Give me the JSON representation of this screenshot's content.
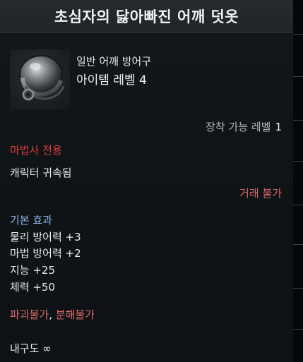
{
  "tooltip": {
    "title": "초심자의 닳아빠진 어깨 덧옷",
    "item_type": "일반 어깨 방어구",
    "item_level": "아이템 레벨 4",
    "equip_level_label": "장착 가능 레벨",
    "equip_level_value": "1",
    "class_restriction": "마법사 전용",
    "binding": "캐릭터 귀속됨",
    "trade": "거래 불가",
    "base_effects_label": "기본 효과",
    "stats": [
      "물리 방어력 +3",
      "마법 방어력 +2",
      "지능 +25",
      "체력 +50"
    ],
    "destroy": "파괴불가",
    "separator": ",",
    "dismantle": "분해불가",
    "durability": "내구도 ∞",
    "icon": "pauldron-armor-icon"
  },
  "colors": {
    "restriction_red": "#e23b3b",
    "effect_blue": "#8fb8e6",
    "warning_red": "#e06a6a"
  }
}
